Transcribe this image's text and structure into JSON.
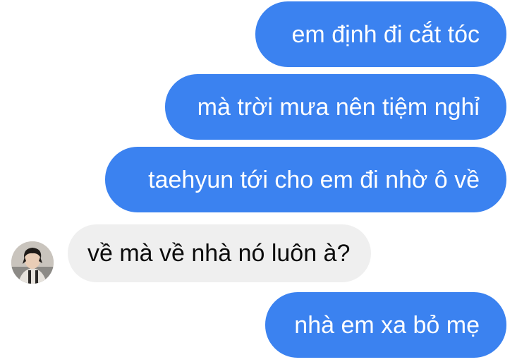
{
  "conversation": {
    "messages": [
      {
        "direction": "outgoing",
        "text": "em định đi cắt tóc"
      },
      {
        "direction": "outgoing",
        "text": "mà trời mưa nên tiệm nghỉ"
      },
      {
        "direction": "outgoing",
        "text": "taehyun tới cho em đi nhờ ô về"
      },
      {
        "direction": "incoming",
        "text": "về mà về nhà nó luôn à?",
        "avatar": "contact-avatar"
      },
      {
        "direction": "outgoing",
        "text": "nhà em xa bỏ mẹ"
      }
    ]
  },
  "colors": {
    "outgoing_bubble": "#3b82f0",
    "incoming_bubble": "#efefef",
    "outgoing_text": "#ffffff",
    "incoming_text": "#0b0b0b"
  }
}
